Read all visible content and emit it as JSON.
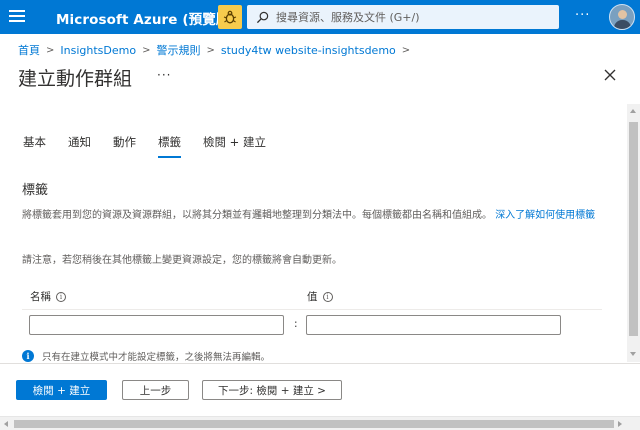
{
  "topbar": {
    "brand": "Microsoft Azure (預覽版)",
    "search_placeholder": "搜尋資源、服務及文件 (G+/)",
    "more": "···",
    "color": "#0078d4"
  },
  "breadcrumb": {
    "items": [
      "首頁",
      "InsightsDemo",
      "警示規則",
      "study4tw website-insightsdemo"
    ],
    "separator": ">"
  },
  "page": {
    "title": "建立動作群組",
    "more": "···"
  },
  "tabs": [
    {
      "label": "基本",
      "active": false
    },
    {
      "label": "通知",
      "active": false
    },
    {
      "label": "動作",
      "active": false
    },
    {
      "label": "標籤",
      "active": true
    },
    {
      "label": "檢閱 + 建立",
      "active": false
    }
  ],
  "tags_section": {
    "title": "標籤",
    "description": "將標籤套用到您的資源及資源群組，以將其分類並有邏輯地整理到分類法中。每個標籤都由名稱和值組成。",
    "learn_more": "深入了解如何使用標籤",
    "note": "請注意，若您稍後在其他標籤上變更資源設定，您的標籤將會自動更新。",
    "name_label": "名稱",
    "value_label": "值",
    "colon": ":",
    "name_value": "",
    "value_value": "",
    "info_message": "只有在建立模式中才能設定標籤，之後將無法再編輯。"
  },
  "footer": {
    "review_create": "檢閱 + 建立",
    "previous": "上一步",
    "next": "下一步: 檢閱 + 建立 >"
  }
}
